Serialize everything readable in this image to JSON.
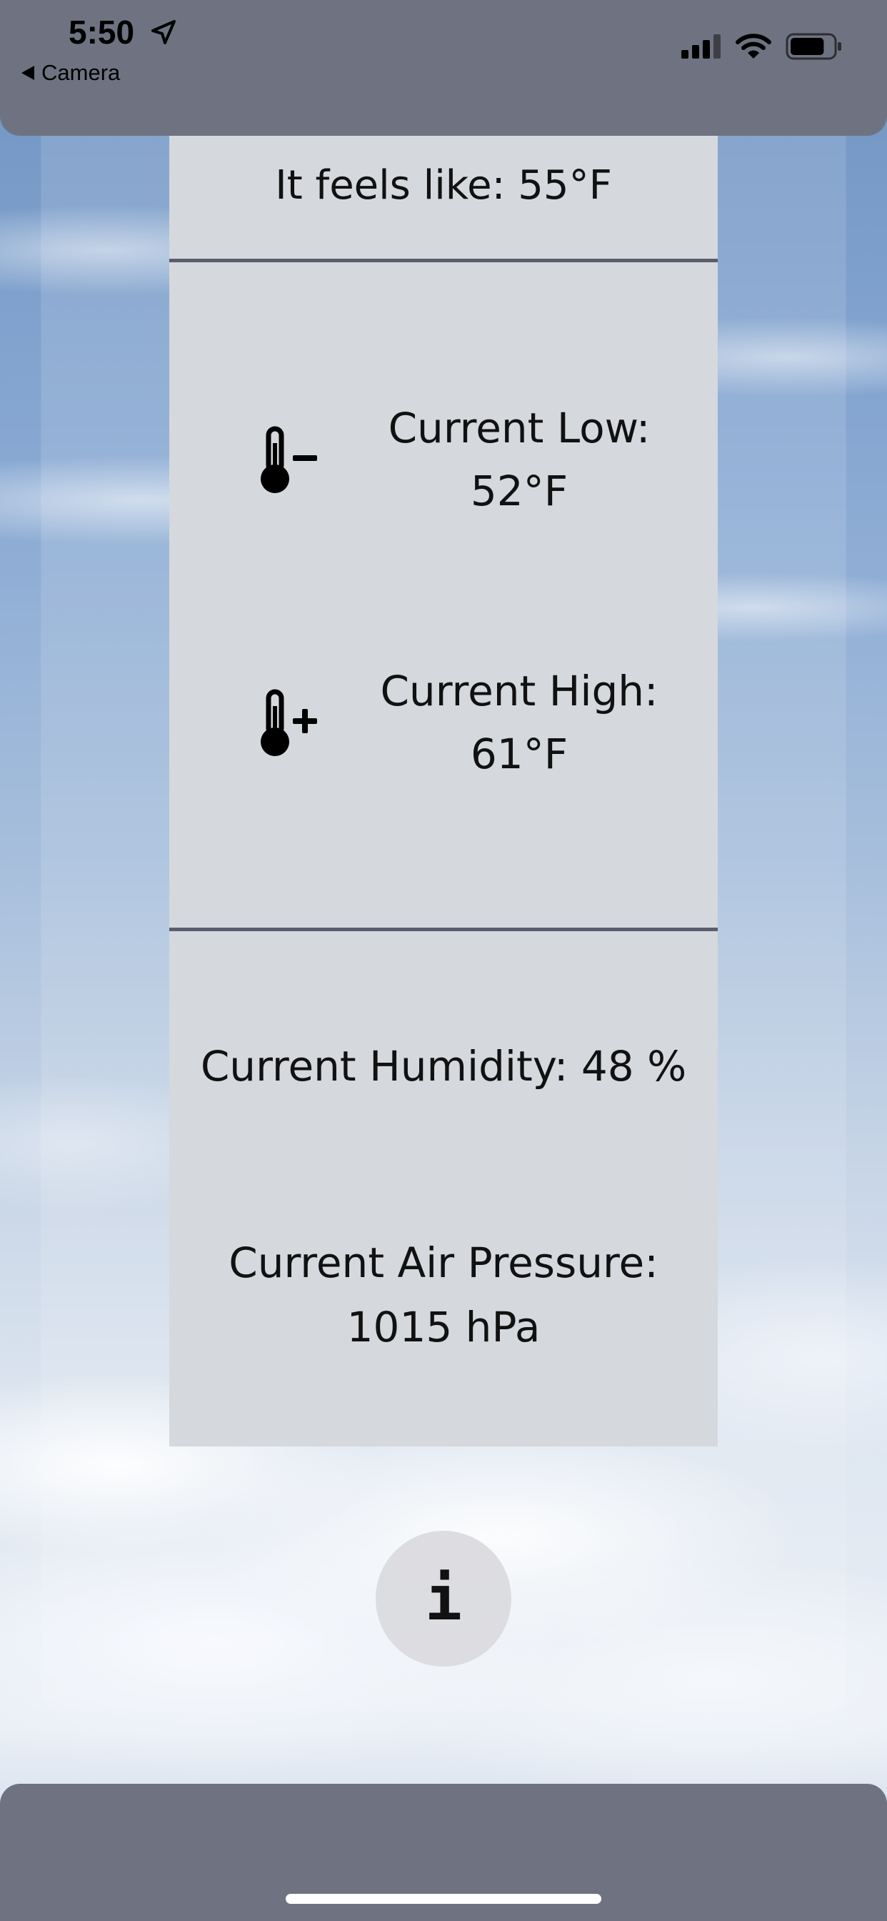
{
  "status_bar": {
    "time": "5:50",
    "back_label": "Camera",
    "location_icon": "location-arrow-icon",
    "signal_icon": "cellular-signal-icon",
    "wifi_icon": "wifi-icon",
    "battery_icon": "battery-icon",
    "battery_level": 0.8
  },
  "weather": {
    "feels_like": "It feels like: 55°F",
    "low_label": "Current Low:",
    "low_value": "52°F",
    "low_icon": "thermometer-minus-icon",
    "high_label": "Current High:",
    "high_value": "61°F",
    "high_icon": "thermometer-plus-icon",
    "humidity": "Current Humidity: 48 %",
    "pressure_label": "Current Air Pressure:",
    "pressure_value": "1015 hPa"
  },
  "info_button": {
    "label": "i",
    "icon": "info-icon"
  },
  "colors": {
    "bar": "#6f7381",
    "card": "#d5d8dd",
    "divider": "#5a5d6d",
    "text": "#111111"
  }
}
